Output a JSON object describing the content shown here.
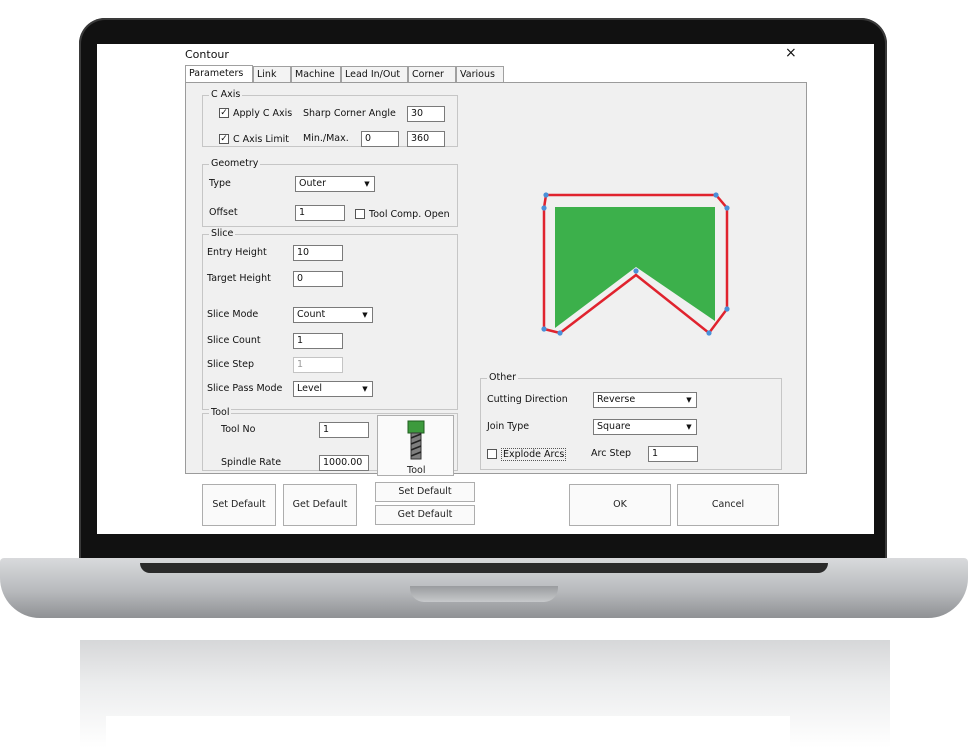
{
  "window": {
    "title": "Contour",
    "close_glyph": "×"
  },
  "tabs": [
    "Parameters",
    "Link",
    "Machine",
    "Lead In/Out",
    "Corner",
    "Various"
  ],
  "c_axis": {
    "legend": "C Axis",
    "apply_label": "Apply C Axis",
    "apply_checked": true,
    "sharp_label": "Sharp Corner Angle",
    "sharp_value": "30",
    "limit_label": "C Axis Limit",
    "limit_checked": true,
    "minmax_label": "Min./Max.",
    "min_value": "0",
    "max_value": "360"
  },
  "geometry": {
    "legend": "Geometry",
    "type_label": "Type",
    "type_value": "Outer",
    "offset_label": "Offset",
    "offset_value": "1",
    "toolcomp_label": "Tool Comp. Open",
    "toolcomp_checked": false
  },
  "slice": {
    "legend": "Slice",
    "entry_label": "Entry Height",
    "entry_value": "10",
    "target_label": "Target Height",
    "target_value": "0",
    "mode_label": "Slice Mode",
    "mode_value": "Count",
    "count_label": "Slice Count",
    "count_value": "1",
    "step_label": "Slice Step",
    "step_value": "1",
    "passmode_label": "Slice Pass Mode",
    "passmode_value": "Level"
  },
  "tool": {
    "legend": "Tool",
    "no_label": "Tool No",
    "no_value": "1",
    "spindle_label": "Spindle Rate",
    "spindle_value": "1000.00",
    "button_label": "Tool"
  },
  "other": {
    "legend": "Other",
    "cutting_label": "Cutting Direction",
    "cutting_value": "Reverse",
    "join_label": "Join Type",
    "join_value": "Square",
    "explode_label": "Explode Arcs",
    "explode_checked": false,
    "arcstep_label": "Arc Step",
    "arcstep_value": "1"
  },
  "footer": {
    "set_default": "Set Default",
    "get_default": "Get Default",
    "set_default_2": "Set Default",
    "get_default_2": "Get Default",
    "ok": "OK",
    "cancel": "Cancel"
  },
  "colors": {
    "preview_fill": "#3cb04b",
    "preview_outline": "#e0232e",
    "preview_vertex": "#4a90d9"
  },
  "icons": {
    "dropdown": "chevron-down-icon",
    "check": "checkmark-icon",
    "tool": "end-mill-icon"
  }
}
